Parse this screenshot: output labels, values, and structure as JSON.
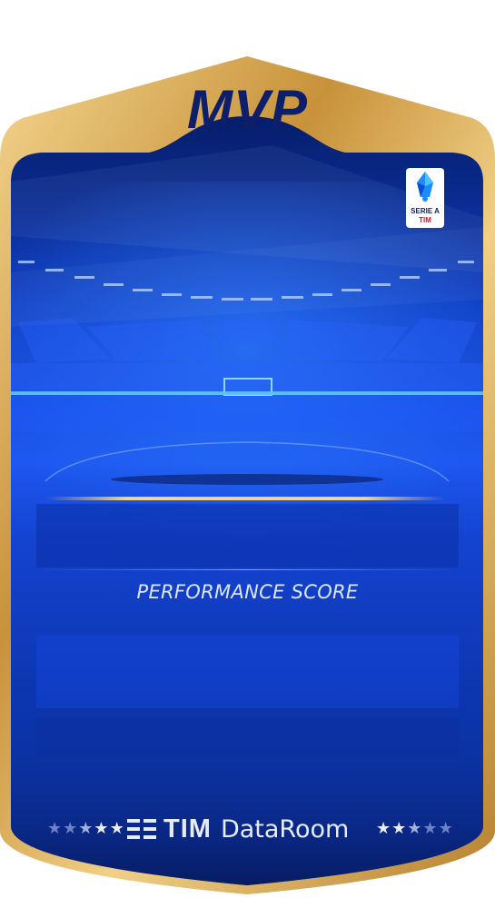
{
  "card": {
    "title": "MVP",
    "performance_label": "PERFORMANCE SCORE",
    "brand_logo_text": "TIM",
    "brand_product": "DataRoom",
    "league_badge_title": "SERIE A",
    "league_badge_sponsor": "TIM",
    "stars_left": "★★★★★",
    "stars_right": "★★★★★"
  },
  "colors": {
    "frame_gold": "#d9ab4f",
    "card_blue_dark": "#07205f",
    "card_blue_bright": "#1d5bff",
    "title_navy": "#0d1f6b",
    "text_light": "#e6ecf7"
  }
}
